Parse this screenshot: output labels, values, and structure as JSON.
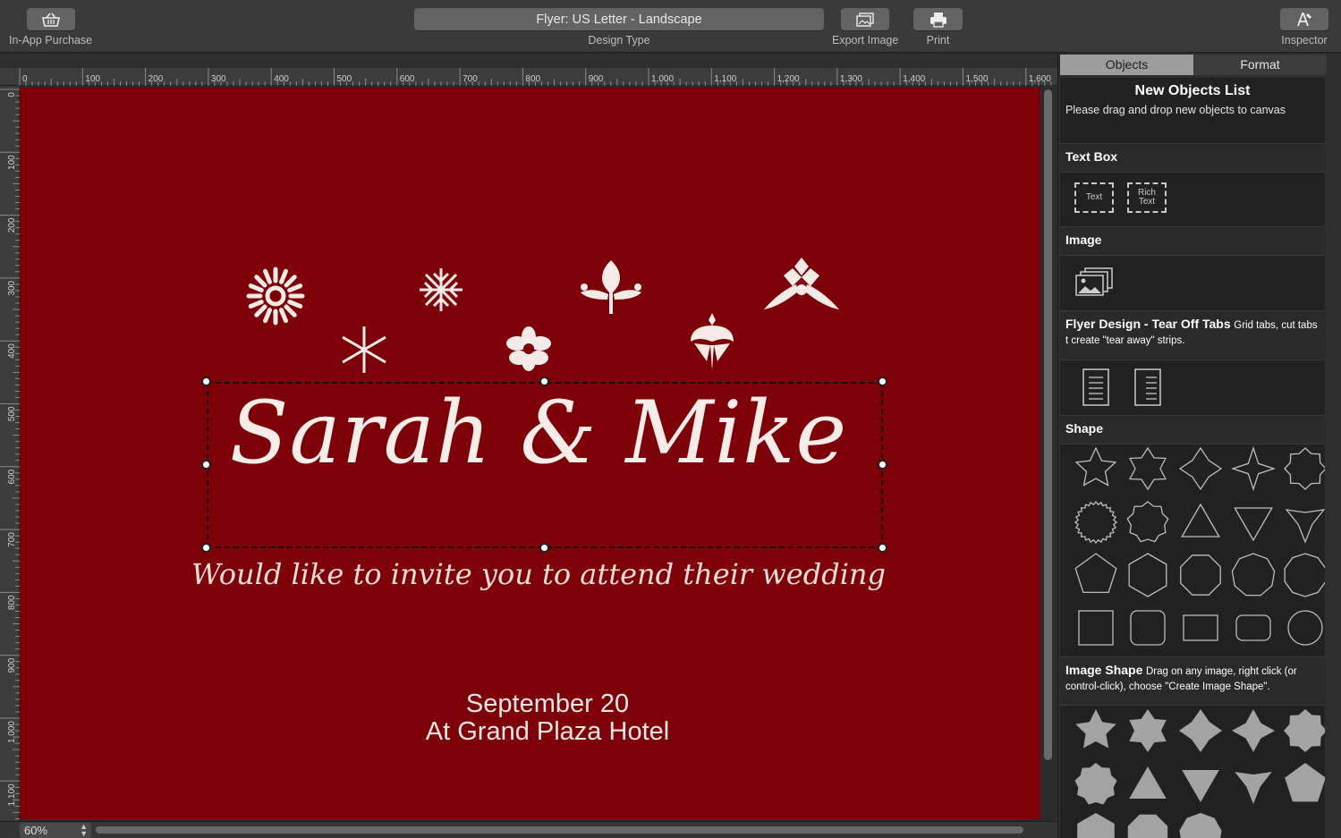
{
  "toolbar": {
    "in_app_purchase_label": "In-App Purchase",
    "design_type_value": "Flyer: US Letter - Landscape",
    "design_type_label": "Design Type",
    "export_image_label": "Export Image",
    "print_label": "Print",
    "inspector_label": "Inspector"
  },
  "rulers": {
    "top_ticks": [
      "0",
      "100",
      "200",
      "300",
      "400",
      "500",
      "600",
      "700",
      "800",
      "900",
      "1,000",
      "1,100",
      "1,200",
      "1,300",
      "1,400",
      "1,500",
      "1,600"
    ],
    "left_ticks": [
      "0",
      "100",
      "200",
      "300",
      "400",
      "500",
      "600",
      "700",
      "800",
      "900",
      "1,000",
      "1,100"
    ]
  },
  "flyer": {
    "background_color": "#7d0009",
    "names": "Sarah & Mike",
    "invitation": "Would like to invite you to attend their wedding",
    "date": "September 20",
    "venue": "At Grand Plaza Hotel"
  },
  "bottom": {
    "zoom_value": "60%"
  },
  "inspector": {
    "tab_objects": "Objects",
    "tab_format": "Format",
    "list_title": "New Objects List",
    "list_subtitle": "Please drag and drop new objects to canvas",
    "sections": {
      "text_box": "Text Box",
      "text_item": "Text",
      "rich_text_item_1": "Rich",
      "rich_text_item_2": "Text",
      "image": "Image",
      "tear_off_title": "Flyer Design - Tear Off Tabs",
      "tear_off_desc": "Grid tabs, cut tabs t create \"tear away\" strips.",
      "shape": "Shape",
      "image_shape_title": "Image Shape",
      "image_shape_desc": "Drag on any image, right click (or control-click), choose \"Create Image Shape\"."
    }
  }
}
